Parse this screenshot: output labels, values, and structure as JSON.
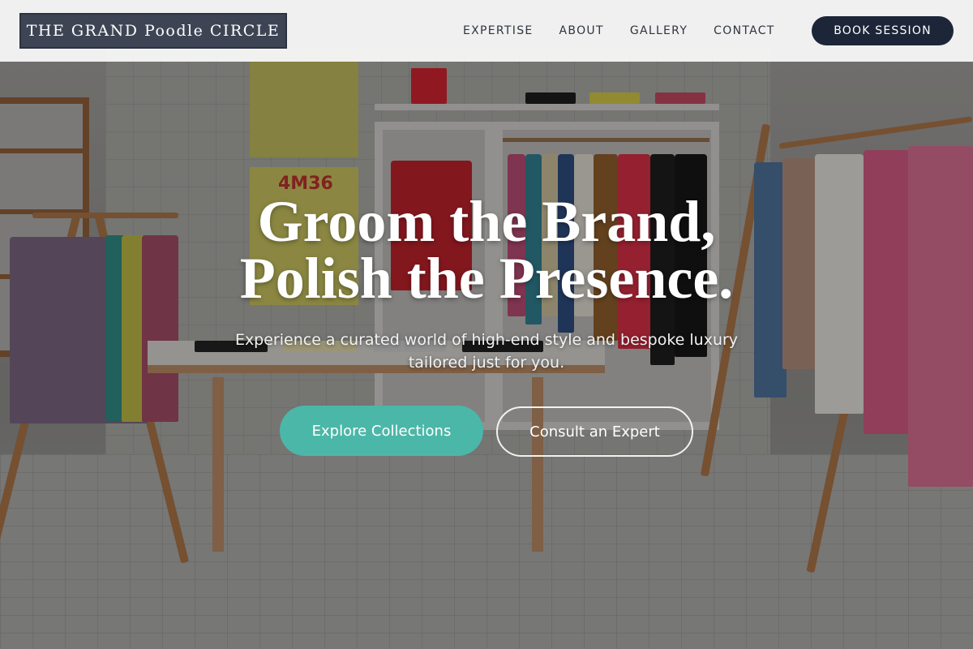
{
  "brand": {
    "name": "THE GRAND Poodle CIRCLE"
  },
  "nav": {
    "items": [
      {
        "label": "EXPERTISE"
      },
      {
        "label": "ABOUT"
      },
      {
        "label": "GALLERY"
      },
      {
        "label": "CONTACT"
      }
    ],
    "cta_label": "BOOK SESSION"
  },
  "hero": {
    "headline_line1": "Groom the Brand,",
    "headline_line2": "Polish the Presence.",
    "subtext": "Experience a curated world of high-end style and bespoke luxury tailored just for you.",
    "primary_button": "Explore Collections",
    "secondary_button": "Consult an Expert",
    "background_image": "boutique-interior-photo",
    "poster_text": "4M36"
  },
  "colors": {
    "brand_box": "#3d4555",
    "nav_background": "#f6f6f6",
    "book_button": "#1d2638",
    "primary_button": "#4bb7a8",
    "text_light": "#ffffff"
  }
}
